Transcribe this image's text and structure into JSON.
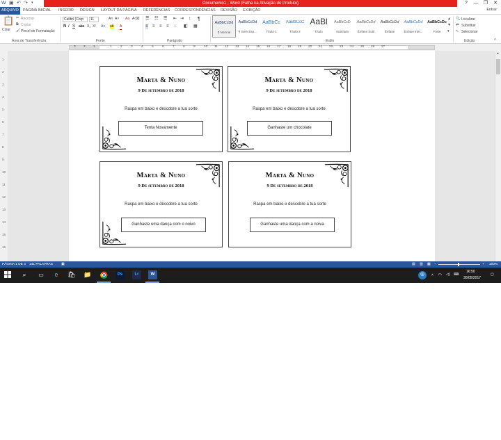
{
  "window": {
    "title": "Documento1 - Word (Falha na Ativação do Produto)",
    "user": "Entrar",
    "minimize_glyph": "—",
    "restore_glyph": "❐",
    "close_glyph": "✕"
  },
  "tabs": [
    {
      "label": "ARQUIVO",
      "active": true
    },
    {
      "label": "PÁGINA INICIAL"
    },
    {
      "label": "INSERIR"
    },
    {
      "label": "DESIGN"
    },
    {
      "label": "LAYOUT DA PÁGINA"
    },
    {
      "label": "REFERÊNCIAS"
    },
    {
      "label": "CORRESPONDÊNCIAS"
    },
    {
      "label": "REVISÃO"
    },
    {
      "label": "EXIBIÇÃO"
    }
  ],
  "ribbon": {
    "clipboard": {
      "paste": "Colar",
      "cut": "Recortar",
      "copy": "Copiar",
      "format_painter": "Pincel de Formatação",
      "group": "Área de Transferência"
    },
    "font": {
      "name": "Calibri (Corp",
      "size": "11",
      "group": "Fonte"
    },
    "paragraph": {
      "group": "Parágrafo"
    },
    "styles": {
      "group": "Estilo",
      "items": [
        {
          "sample": "AaBbCcDd",
          "name": "¶ Normal",
          "selected": true
        },
        {
          "sample": "AaBbCcDd",
          "name": "¶ Sem Esp..."
        },
        {
          "sample": "AaBbCc",
          "name": "Título 1"
        },
        {
          "sample": "AaBbCcC",
          "name": "Título 2"
        },
        {
          "sample": "AaBl",
          "name": "Título",
          "big": true
        },
        {
          "sample": "AaBbCcD",
          "name": "Subtítulo"
        },
        {
          "sample": "AaBbCcDd",
          "name": "Ênfase Sutil"
        },
        {
          "sample": "AaBbCcDd",
          "name": "Ênfase"
        },
        {
          "sample": "AaBbCcDd",
          "name": "Ênfase Inte..."
        },
        {
          "sample": "AaBbCcDc",
          "name": "Forte"
        }
      ]
    },
    "editing": {
      "find": "Localizar",
      "replace": "Substituir",
      "select": "Selecionar",
      "group": "Edição"
    }
  },
  "ruler_numbers": [
    "3",
    "2",
    "1",
    "1",
    "2",
    "3",
    "4",
    "5",
    "6",
    "7",
    "8",
    "9",
    "10",
    "11",
    "12",
    "13",
    "14",
    "15",
    "16",
    "17",
    "18",
    "19",
    "20",
    "21",
    "22",
    "23",
    "24",
    "25",
    "26",
    "27"
  ],
  "vruler_numbers": [
    "1",
    "2",
    "3",
    "4",
    "5",
    "6",
    "7",
    "8",
    "9",
    "10",
    "11",
    "12",
    "13",
    "14",
    "15",
    "16"
  ],
  "cards": [
    {
      "title": "Marta & Nuno",
      "date": "9 De setembro de 2018",
      "instruction": "Raspa em baixo e descobre a tua sorte",
      "prize": "Tenta Novamente"
    },
    {
      "title": "Marta & Nuno",
      "date": "9 De setembro de 2018",
      "instruction": "Raspa em baixo e descobre a tua sorte",
      "prize": "Ganhaste um chocolate"
    },
    {
      "title": "Marta & Nuno",
      "date": "9 De setembro de 2018",
      "instruction": "Raspa em baixo e descobre a tua sorte",
      "prize": "Ganhaste uma dança com o noivo"
    },
    {
      "title": "Marta & Nuno",
      "date": "9 De setembro de 2018",
      "instruction": "Raspa em baixo e descobre a tua sorte",
      "prize": "Ganhaste uma dança com a noiva"
    }
  ],
  "status": {
    "page": "PÁGINA 1 DE 4",
    "words": "141 PALAVRAS",
    "zoom_minus": "−",
    "zoom_plus": "+",
    "zoom": "100%"
  },
  "taskbar": {
    "time": "16:50",
    "date": "30/05/2017",
    "apps": [
      {
        "name": "photoshop",
        "label": "Ps",
        "color": "#0c1a3a"
      },
      {
        "name": "lightroom",
        "label": "Lr",
        "color": "#1b2c4a"
      },
      {
        "name": "word",
        "label": "W",
        "color": "#2b579a"
      }
    ]
  },
  "colors": {
    "accent": "#2b579a",
    "titlebar": "#e7211b"
  }
}
